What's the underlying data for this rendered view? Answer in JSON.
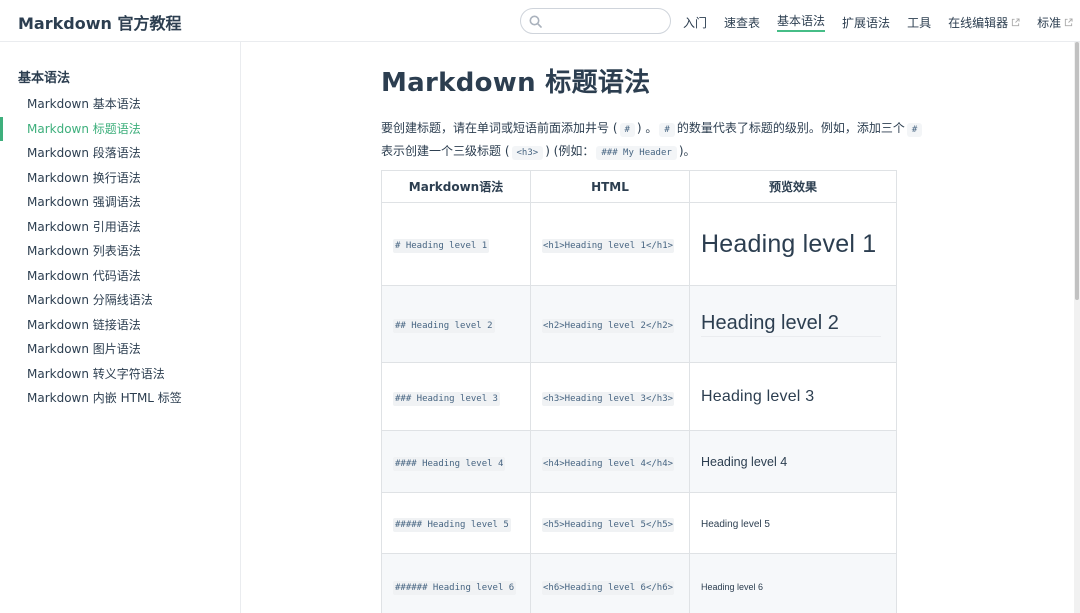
{
  "navbar": {
    "site_title": "Markdown 官方教程",
    "search_placeholder": "",
    "links": [
      {
        "label": "入门"
      },
      {
        "label": "速查表"
      },
      {
        "label": "基本语法"
      },
      {
        "label": "扩展语法"
      },
      {
        "label": "工具"
      },
      {
        "label": "在线编辑器"
      },
      {
        "label": "标准"
      }
    ]
  },
  "sidebar": {
    "heading": "基本语法",
    "items": [
      {
        "label": "Markdown 基本语法"
      },
      {
        "label": "Markdown 标题语法"
      },
      {
        "label": "Markdown 段落语法"
      },
      {
        "label": "Markdown 换行语法"
      },
      {
        "label": "Markdown 强调语法"
      },
      {
        "label": "Markdown 引用语法"
      },
      {
        "label": "Markdown 列表语法"
      },
      {
        "label": "Markdown 代码语法"
      },
      {
        "label": "Markdown 分隔线语法"
      },
      {
        "label": "Markdown 链接语法"
      },
      {
        "label": "Markdown 图片语法"
      },
      {
        "label": "Markdown 转义字符语法"
      },
      {
        "label": "Markdown 内嵌 HTML 标签"
      }
    ]
  },
  "main": {
    "title": "Markdown 标题语法",
    "intro": {
      "t1": "要创建标题，请在单词或短语前面添加井号 (",
      "c1": "#",
      "t2": ") 。",
      "c2": "#",
      "t3": "的数量代表了标题的级别。例如，添加三个",
      "c3": "#",
      "t4": "表示创建一个三级标题 (",
      "c4": "<h3>",
      "t5": ") (例如：",
      "c5": "### My Header",
      "t6": ")。"
    },
    "table": {
      "headers": [
        "Markdown语法",
        "HTML",
        "预览效果"
      ],
      "rows": [
        {
          "md": "# Heading level 1",
          "html": "<h1>Heading level 1</h1>",
          "preview": "Heading level 1"
        },
        {
          "md": "## Heading level 2",
          "html": "<h2>Heading level 2</h2>",
          "preview": "Heading level 2"
        },
        {
          "md": "### Heading level 3",
          "html": "<h3>Heading level 3</h3>",
          "preview": "Heading level 3"
        },
        {
          "md": "#### Heading level 4",
          "html": "<h4>Heading level 4</h4>",
          "preview": "Heading level 4"
        },
        {
          "md": "##### Heading level 5",
          "html": "<h5>Heading level 5</h5>",
          "preview": "Heading level 5"
        },
        {
          "md": "###### Heading level 6",
          "html": "<h6>Heading level 6</h6>",
          "preview": "Heading level 6"
        }
      ]
    }
  },
  "colors": {
    "accent": "#3eaf7c",
    "text": "#2c3e50",
    "code_text": "#476582",
    "border": "#eaecef"
  },
  "icons": [
    "search-icon",
    "external-link-icon"
  ]
}
